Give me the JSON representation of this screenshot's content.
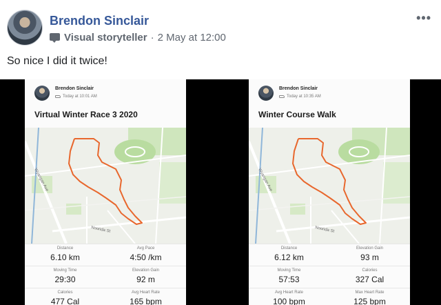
{
  "post": {
    "author": "Brendon Sinclair",
    "role": "Visual storyteller",
    "separator": "·",
    "date": "2 May at 12:00",
    "more": "•••",
    "text": "So nice I did it twice!"
  },
  "activities": [
    {
      "athlete": "Brendon Sinclair",
      "time": "Today at 10:01 AM",
      "title": "Virtual Winter Race 3 2020",
      "map": {
        "street_1": "Wyangan Ave",
        "street_2": "Noonda St"
      },
      "stats": [
        {
          "label": "Distance",
          "value": "6.10 km"
        },
        {
          "label": "Avg Pace",
          "value": "4:50 /km"
        },
        {
          "label": "Moving Time",
          "value": "29:30"
        },
        {
          "label": "Elevation Gain",
          "value": "92 m"
        },
        {
          "label": "Calories",
          "value": "477 Cal"
        },
        {
          "label": "Avg Heart Rate",
          "value": "165 bpm"
        }
      ]
    },
    {
      "athlete": "Brendon Sinclair",
      "time": "Today at 10:35 AM",
      "title": "Winter Course Walk",
      "map": {
        "street_1": "Wyangan Ave",
        "street_2": "Noonda St"
      },
      "stats": [
        {
          "label": "Distance",
          "value": "6.12 km"
        },
        {
          "label": "Elevation Gain",
          "value": "93 m"
        },
        {
          "label": "Moving Time",
          "value": "57:53"
        },
        {
          "label": "Calories",
          "value": "327 Cal"
        },
        {
          "label": "Avg Heart Rate",
          "value": "100 bpm"
        },
        {
          "label": "Max Heart Rate",
          "value": "125 bpm"
        }
      ]
    }
  ],
  "colors": {
    "author_link": "#365899",
    "route": "#e8672d",
    "park": "#b9dca0",
    "map_bg": "#eef0ea"
  }
}
